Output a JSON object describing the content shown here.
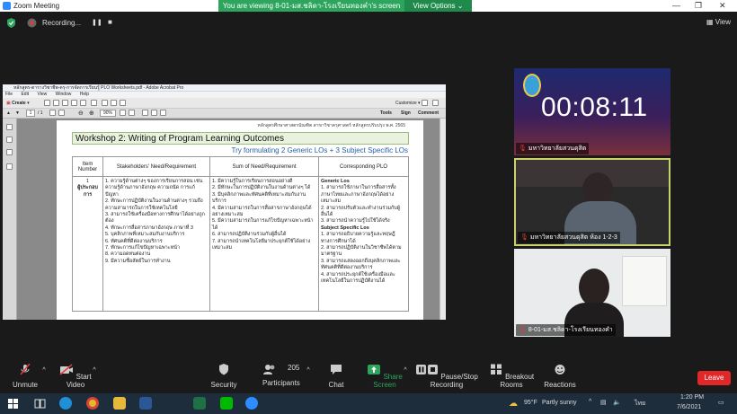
{
  "window": {
    "title": "Zoom Meeting",
    "minimize": "—",
    "maximize": "❐",
    "close": "✕"
  },
  "share_banner": {
    "text": "You are viewing 8-01-มส.ชลิดา-โรงเรียนทองคำ's screen",
    "view_options": "View Options"
  },
  "zoom_top": {
    "recording_label": "Recording...",
    "pause": "❚❚",
    "stop": "■",
    "view_label": "View"
  },
  "acrobat": {
    "title": "หลักสูตร-ตารางวิชาชีพ-ครุ-การจัดการเรียนรู้ PLO Worksheets.pdf - Adobe Acrobat Pro",
    "menu": [
      "File",
      "Edit",
      "View",
      "Window",
      "Help"
    ],
    "create_label": "Create",
    "page_num": "1",
    "page_total": "/ 1",
    "zoom": "90%",
    "customize": "Customize",
    "tools": "Tools",
    "sign": "Sign",
    "comment": "Comment"
  },
  "doc": {
    "header": "หลักสูตรศึกษาศาสตรบัณฑิต สาขาวิชาครุศาสตร์ หลักสูตรปรับปรุง พ.ศ. 2565",
    "title": "Workshop 2: Writing of Program Learning Outcomes",
    "subtitle": "Try formulating 2 Generic LOs + 3 Subject Specific LOs",
    "headers": [
      "Item Number",
      "Stakeholders' Need/Requirement",
      "Sum of Need/Requirement",
      "Corresponding PLO"
    ],
    "item_number": "1",
    "item_label": "ผู้ประกอบการ",
    "col2": [
      "1. ความรู้ด้านต่างๆ ของการเรียนการสอน เช่น ความรู้ด้านภาษาอังกฤษ ความถนัด การแก้ปัญหา",
      "2. ทักษะการปฏิบัติงานในงานด้านต่างๆ รวมถึงความสามารถในการใช้เทคโนโลยี",
      "3. สามารถใช้เครื่องมือทางการศึกษาได้อย่างถูกต้อง",
      "4. ทักษะการสื่อสารภาษาอังกฤษ ภาษาที่ 3",
      "5. บุคลิกภาพที่เหมาะสมกับงานบริการ",
      "6. ทัศนคติที่ดีต่องานบริการ",
      "7. ทักษะการแก้ไขปัญหาเฉพาะหน้า",
      "8. ความอดทนต่องาน",
      "9. มีความซื่อสัตย์ในการทำงาน"
    ],
    "col3": [
      "1. มีความรู้ในการเรียนการสอนอย่างดี",
      "2. มีทักษะในการปฏิบัติงานในงานด้านต่างๆ ได้",
      "3. มีบุคลิกภาพและทัศนคติที่เหมาะสมกับงานบริการ",
      "4. มีความสามารถในการสื่อสารภาษาอังกฤษได้อย่างเหมาะสม",
      "5. มีความสามารถในการแก้ไขปัญหาเฉพาะหน้าได้",
      "6. สามารถปฏิบัติงานร่วมกับผู้อื่นได้",
      "7. สามารถนำเทคโนโลยีมาประยุกต์ใช้ได้อย่างเหมาะสม"
    ],
    "generic_heading": "Generic Los",
    "col4_generic": [
      "1. สามารถใช้ภาษาในการสื่อสารทั้งภาษาไทยและภาษาอังกฤษได้อย่างเหมาะสม",
      "2. สามารถปรับตัวและทำงานร่วมกับผู้อื่นได้",
      "3. สามารถนำความรู้ไปใช้ได้จริง"
    ],
    "specific_heading": "Subject Specific Los",
    "col4_specific": [
      "1. สามารถอธิบายความรู้และทฤษฎีทางการศึกษาได้",
      "2. สามารถปฏิบัติงานในวิชาชีพได้ตามมาตรฐาน",
      "3. สามารถแสดงออกถึงบุคลิกภาพและทัศนคติที่ดีต่องานบริการ",
      "4. สามารถประยุกต์ใช้เครื่องมือและเทคโนโลยีในการปฏิบัติงานได้"
    ]
  },
  "gallery": {
    "timer": "00:08:11",
    "tile1_name": "มหาวิทยาลัยสวนดุสิต",
    "tile2_name": "มหาวิทยาลัยสวนดุสิต ห้อง 1-2-3",
    "tile3_name": "8-01-มส.ชลิดา-โรงเรียนทองคำ"
  },
  "toolbar": {
    "unmute": "Unmute",
    "start_video": "Start Video",
    "security": "Security",
    "participants": "Participants",
    "participants_count": "205",
    "chat": "Chat",
    "share_screen": "Share Screen",
    "pause_recording": "Pause/Stop Recording",
    "breakout": "Breakout Rooms",
    "reactions": "Reactions",
    "leave": "Leave"
  },
  "taskbar": {
    "weather_temp": "95°F",
    "weather_text": "Partly sunny",
    "lang": "ไทย",
    "time": "1:20 PM",
    "date": "7/6/2021"
  },
  "colors": {
    "accent": "#2d8cff",
    "share_green": "#2da55d",
    "leave_red": "#e02828",
    "speaker_border": "#c9d26a"
  }
}
